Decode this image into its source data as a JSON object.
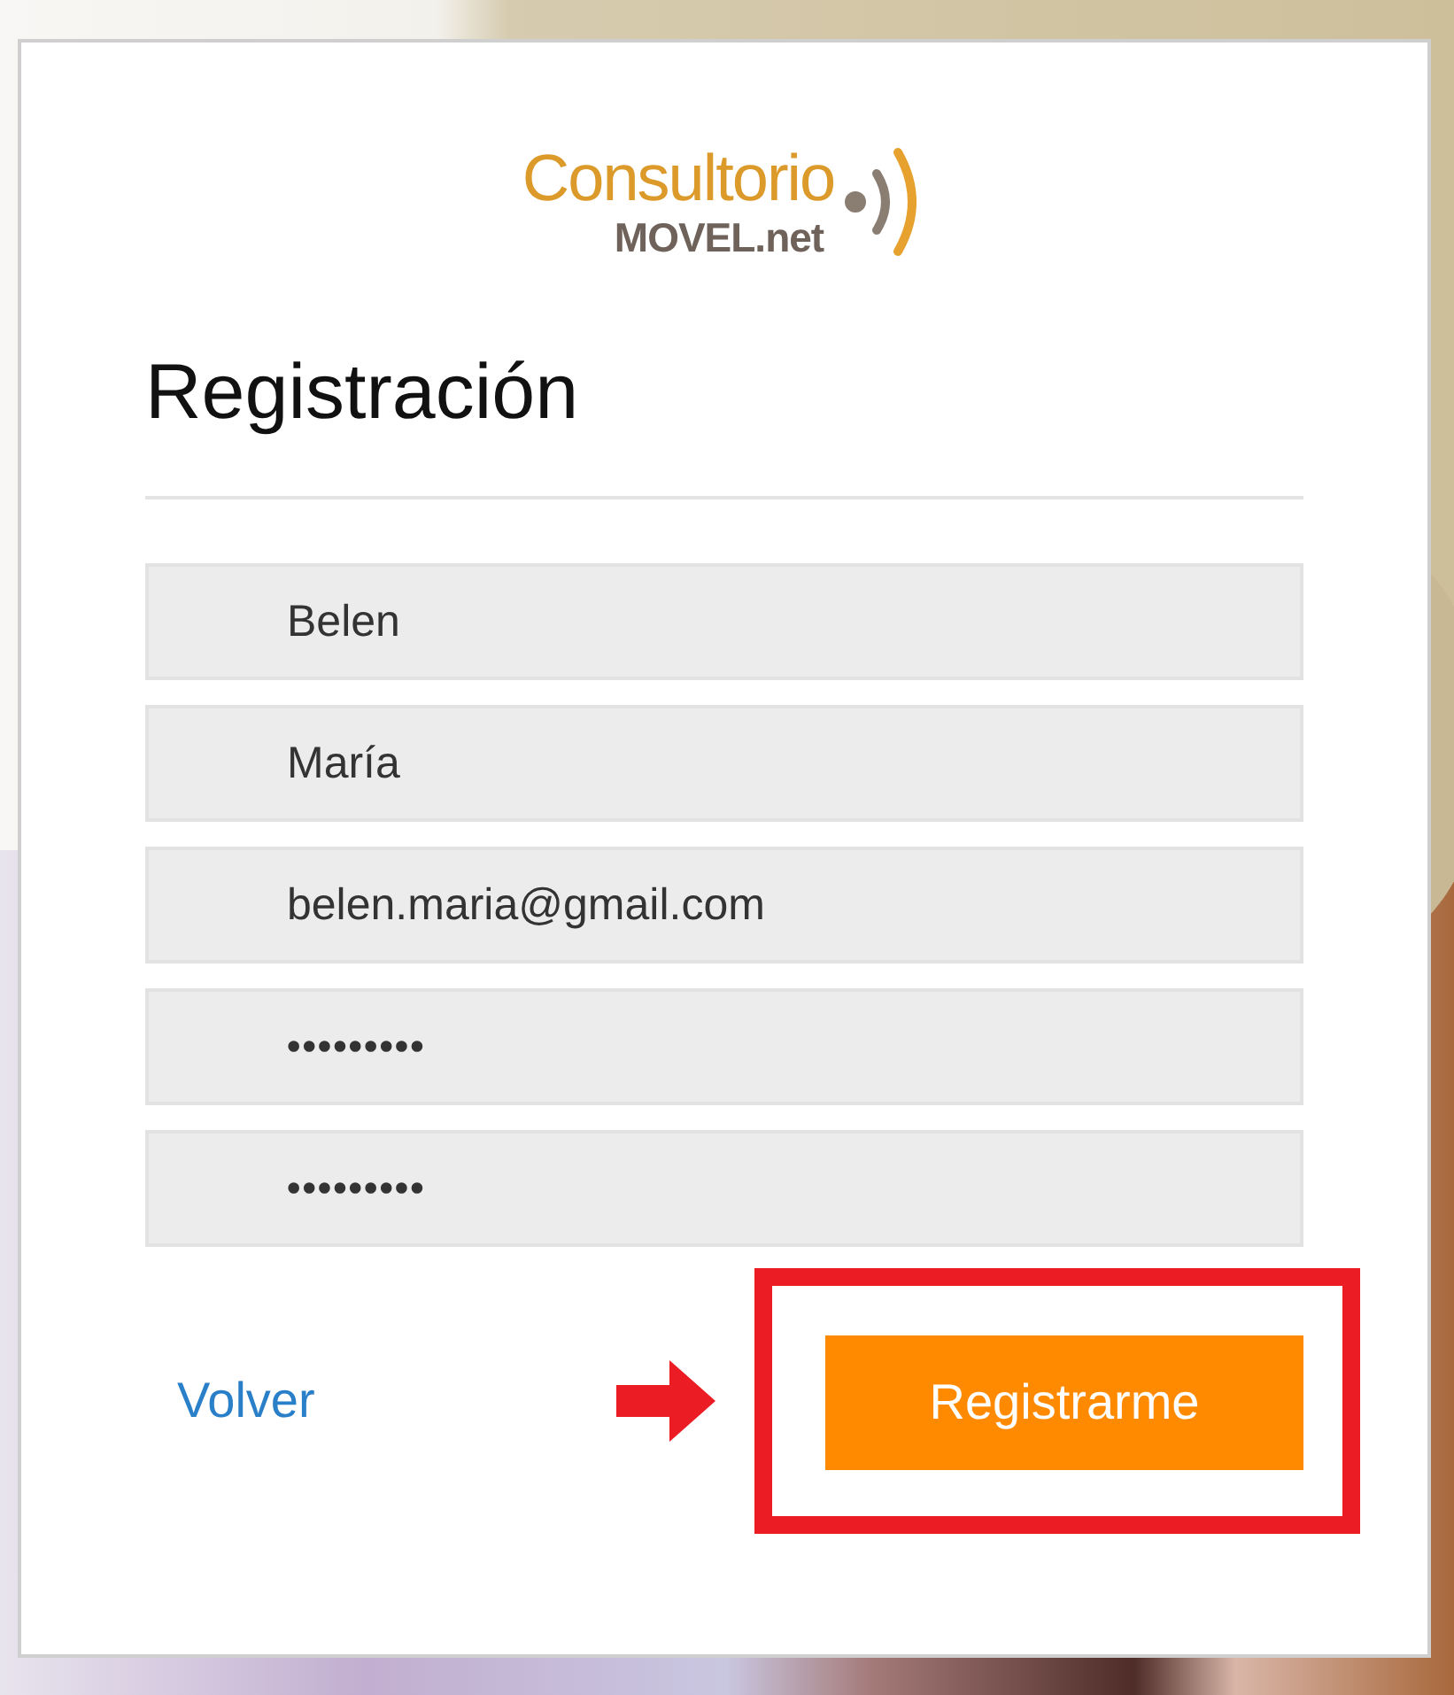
{
  "logo": {
    "name": "Consultorio",
    "suffix": "MOVEL.net"
  },
  "title": "Registración",
  "fields": [
    {
      "value": "Belen",
      "kind": "text"
    },
    {
      "value": "María",
      "kind": "text"
    },
    {
      "value": "belen.maria@gmail.com",
      "kind": "text"
    },
    {
      "value": "•••••••••",
      "kind": "password"
    },
    {
      "value": "•••••••••",
      "kind": "password"
    }
  ],
  "back_link": "Volver",
  "submit_button": "Registrarme"
}
